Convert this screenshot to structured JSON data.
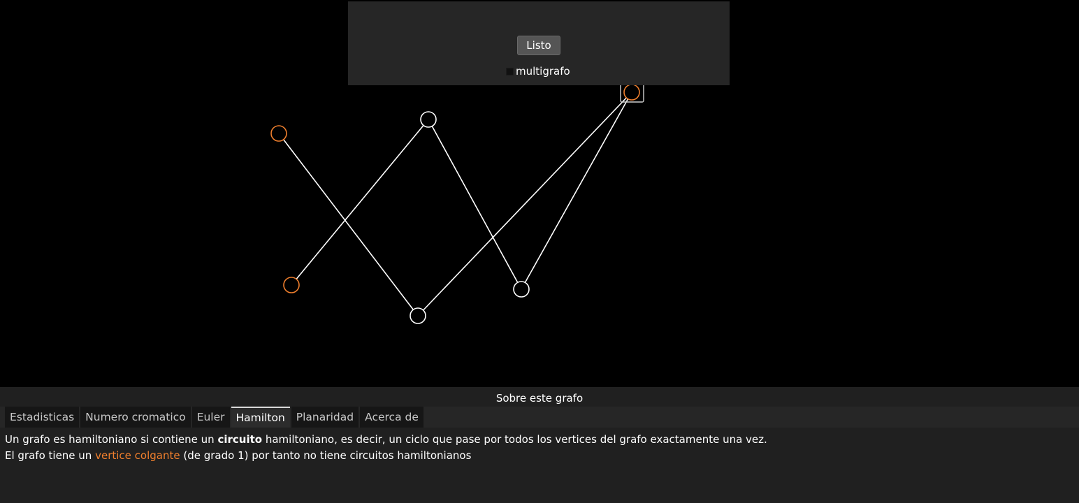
{
  "top_panel": {
    "done_label": "Listo",
    "multigraph_label": "multigrafo",
    "multigraph_checked": false
  },
  "graph": {
    "vertex_color_default": "#ffffff",
    "vertex_color_pendant": "#f07f2d",
    "edge_color": "#ffffff",
    "selection_color": "#cfcfcf"
  },
  "bottom_panel": {
    "title": "Sobre este grafo",
    "tabs": [
      {
        "label": "Estadisticas",
        "active": false
      },
      {
        "label": "Numero cromatico",
        "active": false
      },
      {
        "label": "Euler",
        "active": false
      },
      {
        "label": "Hamilton",
        "active": true
      },
      {
        "label": "Planaridad",
        "active": false
      },
      {
        "label": "Acerca de",
        "active": false
      }
    ],
    "line1_pre": "Un grafo es hamiltoniano si contiene un ",
    "line1_bold": "circuito",
    "line1_post": " hamiltoniano, es decir, un ciclo que pase por todos los vertices del grafo exactamente una vez.",
    "line2_pre": "El grafo tiene un ",
    "line2_highlight": "vertice colgante",
    "line2_post": " (de grado 1) por tanto no tiene circuitos hamiltonianos"
  }
}
